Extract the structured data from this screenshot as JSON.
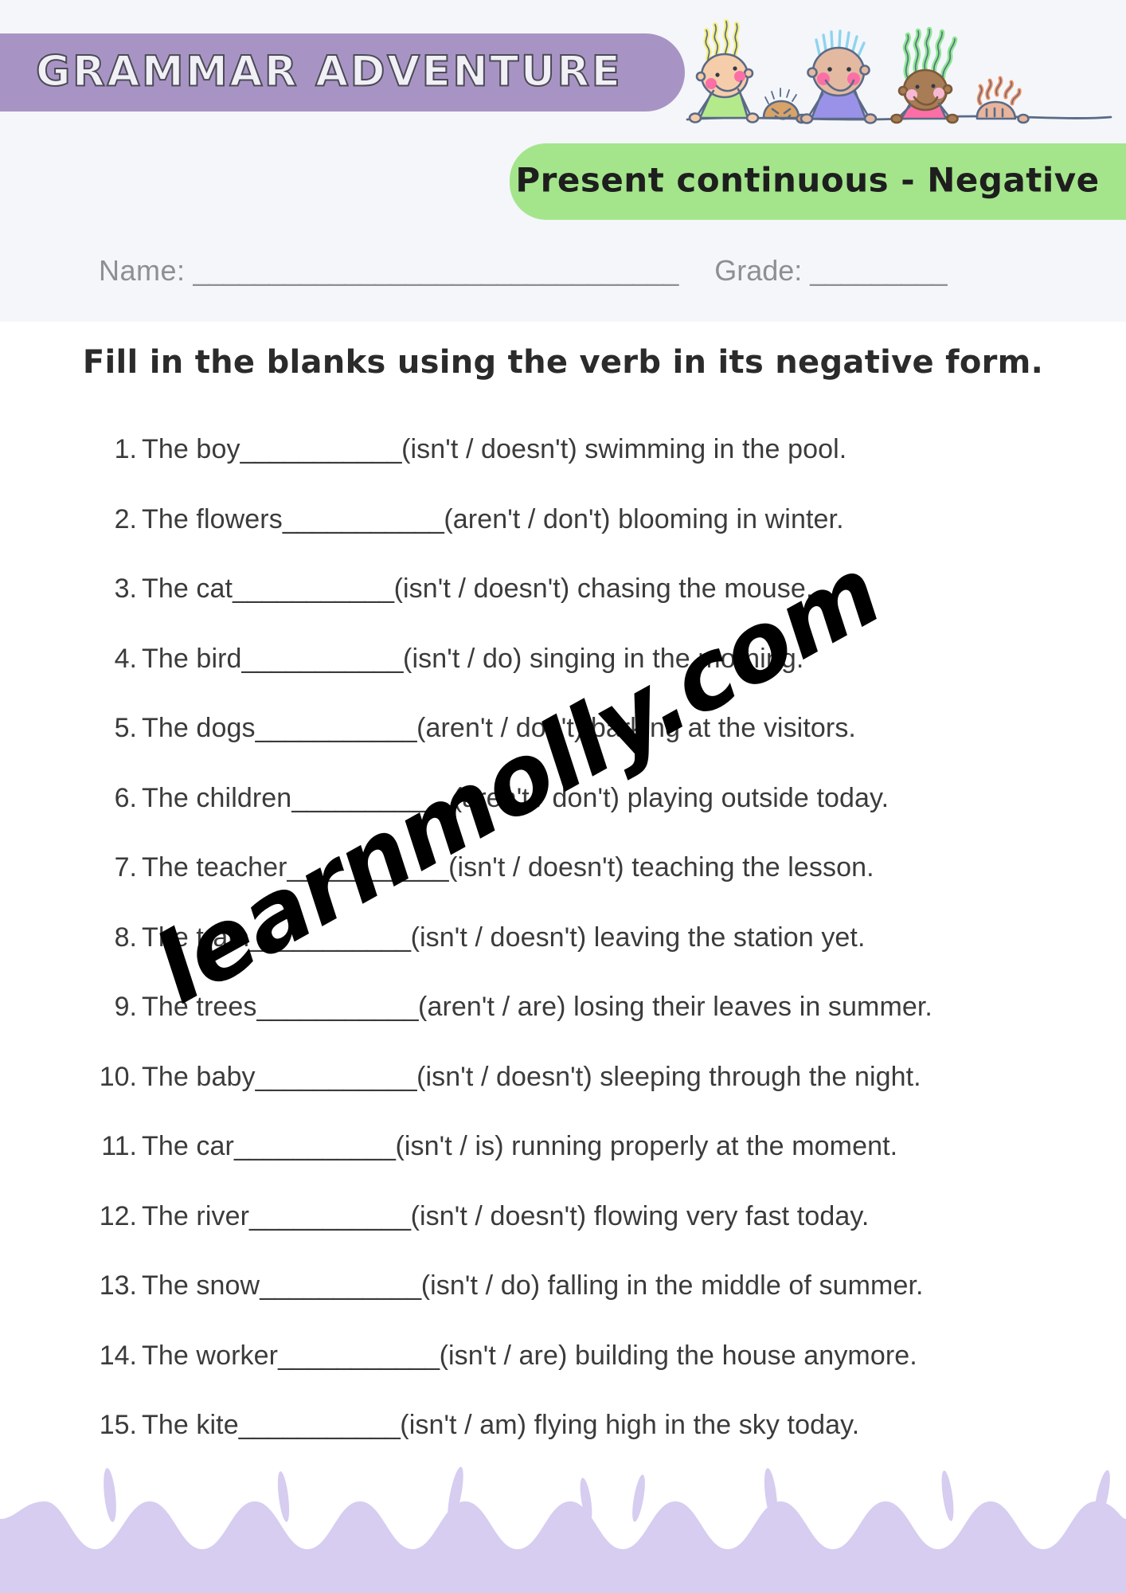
{
  "header": {
    "banner_title": "GRAMMAR ADVENTURE",
    "topic_badge": "Present continuous - Negative",
    "banner_color": "#a894c4",
    "badge_color": "#a4e58c",
    "band_color": "#f4f6fa"
  },
  "student_fields": {
    "name_label": "Name:",
    "name_rule": "________________________________",
    "grade_label": "Grade:",
    "grade_rule": "_________"
  },
  "instruction": "Fill in the blanks using the verb in its negative form.",
  "watermark": "learnmolly.com",
  "questions": [
    {
      "num": "1.",
      "before": "The boy ",
      "blank": "___________",
      "after": " (isn't / doesn't) swimming in the pool."
    },
    {
      "num": "2.",
      "before": "The flowers ",
      "blank": "___________",
      "after": " (aren't / don't) blooming in winter."
    },
    {
      "num": "3.",
      "before": "The cat ",
      "blank": "___________",
      "after": " (isn't / doesn't) chasing the mouse."
    },
    {
      "num": "4.",
      "before": "The bird ",
      "blank": "___________",
      "after": " (isn't / do) singing in the morning."
    },
    {
      "num": "5.",
      "before": "The dogs ",
      "blank": "___________",
      "after": " (aren't / don't) barking at the visitors."
    },
    {
      "num": "6.",
      "before": "The children ",
      "blank": "___________",
      "after": " (aren't / don't) playing outside today."
    },
    {
      "num": "7.",
      "before": "The teacher ",
      "blank": "___________",
      "after": " (isn't / doesn't) teaching the lesson."
    },
    {
      "num": "8.",
      "before": "The train ",
      "blank": "___________",
      "after": " (isn't / doesn't) leaving the station yet."
    },
    {
      "num": "9.",
      "before": "The trees ",
      "blank": "___________",
      "after": " (aren't / are) losing their leaves in summer."
    },
    {
      "num": "10.",
      "before": "The baby ",
      "blank": "___________",
      "after": " (isn't / doesn't) sleeping through the night."
    },
    {
      "num": "11.",
      "before": "The car ",
      "blank": "___________",
      "after": " (isn't / is) running properly at the moment."
    },
    {
      "num": "12.",
      "before": "The river ",
      "blank": "___________",
      "after": " (isn't / doesn't) flowing very fast today."
    },
    {
      "num": "13.",
      "before": "The snow ",
      "blank": "___________",
      "after": " (isn't / do) falling in the middle of summer."
    },
    {
      "num": "14.",
      "before": "The worker ",
      "blank": "___________",
      "after": " (isn't / are) building the house anymore."
    },
    {
      "num": "15.",
      "before": "The kite ",
      "blank": "___________",
      "after": " (isn't / am) flying high in the sky today."
    }
  ],
  "decoration": {
    "wave_color": "#d6cdf0",
    "kids": [
      {
        "name": "kid-yellow-hair",
        "hair": "#f5ef7a",
        "skin": "#f6cdaa",
        "shirt": "#b4ea8c"
      },
      {
        "name": "kid-brown-spiky",
        "hair": "#d9a367",
        "skin": "#d9a367",
        "shirt": "#d9a367"
      },
      {
        "name": "kid-blue-hair",
        "hair": "#8ed4f0",
        "skin": "#e3b9a2",
        "shirt": "#9a92e8"
      },
      {
        "name": "kid-green-hair",
        "hair": "#8ce890",
        "skin": "#a87c55",
        "shirt": "#fb6fa6"
      },
      {
        "name": "kid-orange-hair",
        "hair": "#f09060",
        "skin": "#e8b49c",
        "shirt": "#e8b49c"
      }
    ]
  }
}
